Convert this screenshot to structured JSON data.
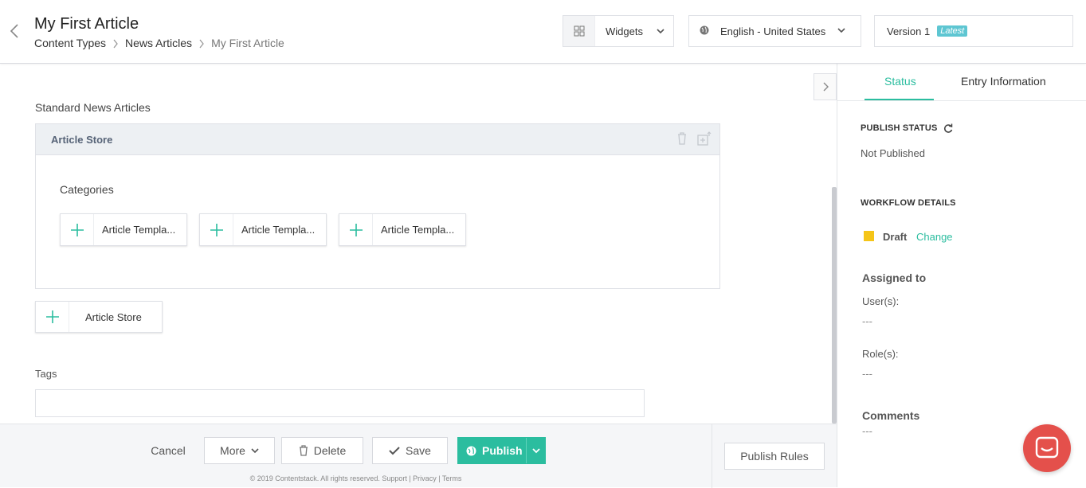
{
  "header": {
    "title": "My First Article",
    "breadcrumbs": [
      "Content Types",
      "News Articles",
      "My First Article"
    ],
    "widgets_label": "Widgets",
    "language_label": "English - United States",
    "version_label": "Version 1",
    "version_badge": "Latest"
  },
  "main": {
    "section_label": "Standard News Articles",
    "group_title": "Article Store",
    "categories_label": "Categories",
    "templates": [
      "Article Templa...",
      "Article Templa...",
      "Article Templa..."
    ],
    "add_button_label": "Article Store",
    "tags_label": "Tags"
  },
  "footer": {
    "cancel": "Cancel",
    "more": "More",
    "delete": "Delete",
    "save": "Save",
    "publish": "Publish",
    "publish_rules": "Publish Rules",
    "copyright": "© 2019 Contentstack. All rights reserved. Support | Privacy | Terms"
  },
  "panel": {
    "tabs": [
      "Status",
      "Entry Information"
    ],
    "publish_status_heading": "PUBLISH STATUS",
    "publish_status_value": "Not Published",
    "workflow_heading": "WORKFLOW DETAILS",
    "workflow_stage": "Draft",
    "workflow_change": "Change",
    "assigned_heading": "Assigned to",
    "users_label": "User(s):",
    "users_value": "---",
    "roles_label": "Role(s):",
    "roles_value": "---",
    "comments_heading": "Comments",
    "comments_value": "---"
  },
  "colors": {
    "accent": "#2bbd9f",
    "draft": "#f5c518",
    "badge": "#5ec6d2",
    "chat": "#e4504b"
  }
}
